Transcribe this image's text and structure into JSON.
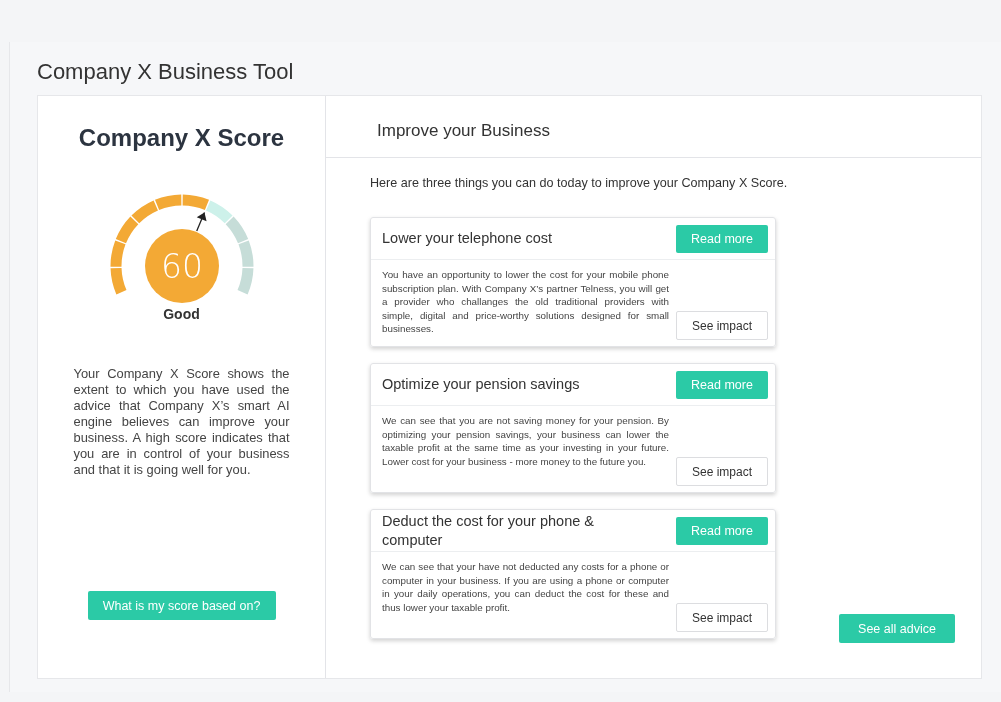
{
  "page_title": "Company X Business Tool",
  "score_panel": {
    "title": "Company X Score",
    "gauge": {
      "score": "60",
      "rating": "Good"
    },
    "description": "Your Company X Score shows the extent to which you have used the advice that Company X’s smart AI engine believes can improve your business. A high score indicates that you are in control of your business and that it is going well for you.",
    "button": "What is my score based on?"
  },
  "advice_panel": {
    "title": "Improve your Business",
    "intro": "Here are three things you can do today to improve your Company X Score.",
    "cards": [
      {
        "title": "Lower your telephone cost",
        "read_more": "Read more",
        "text": "You have an opportunity to lower the cost for your mobile phone subscription plan. With Company X’s partner Telness, you will get a provider who challanges the old traditional providers with simple, digital and price-worthy solutions designed for small businesses.",
        "impact": "See impact"
      },
      {
        "title": "Optimize your pension savings",
        "read_more": "Read more",
        "text": "We can see that you are not saving money for your pension. By optimizing your pension savings, your business can lower the taxable profit at the same time as your investing in your future. Lower cost for your business - more money to the future you.",
        "impact": "See impact"
      },
      {
        "title": "Deduct the cost for your phone & computer",
        "read_more": "Read more",
        "text": "We can see that your have not deducted any costs for a phone or computer in your business. If you are using a phone or computer in your daily operations, you can deduct the cost for these and thus lower your taxable profit.",
        "impact": "See impact"
      }
    ],
    "button": "See all advice"
  }
}
